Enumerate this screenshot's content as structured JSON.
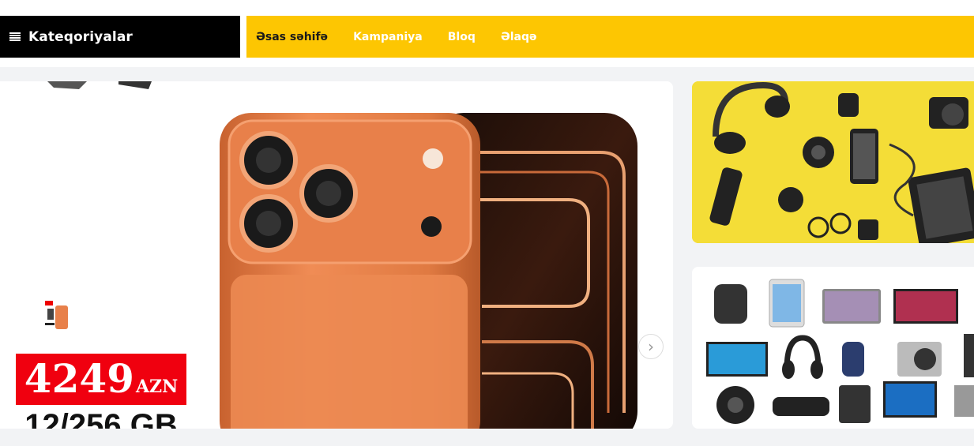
{
  "header": {
    "categories_label": "Kateqoriyalar",
    "nav": [
      {
        "label": "Əsas səhifə"
      },
      {
        "label": "Kampaniya"
      },
      {
        "label": "Bloq"
      },
      {
        "label": "Əlaqə"
      }
    ]
  },
  "slider": {
    "price_value": "4249",
    "price_currency": "AZN",
    "storage": "12/256 GB",
    "next_icon": "chevron-right-icon"
  },
  "banners": {
    "top_icon": "electronics-flatlay-image",
    "bottom_icon": "electronics-collage-image"
  },
  "colors": {
    "nav_background": "#fdc602",
    "categories_background": "#000000",
    "price_background": "#f0000f",
    "phone_orange": "#e8804a",
    "banner_yellow": "#f4dd37"
  }
}
